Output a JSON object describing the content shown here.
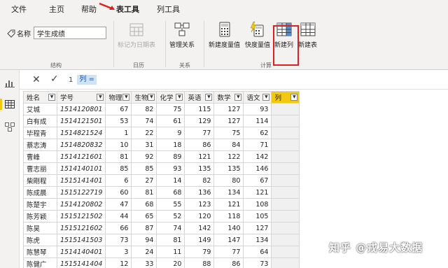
{
  "menu": {
    "file": "文件",
    "home": "主页",
    "help": "帮助",
    "table_tools": "表工具",
    "column_tools": "列工具"
  },
  "ribbon": {
    "name_label": "名称",
    "name_value": "学生成绩",
    "mark_date_table": "标记为日期表",
    "manage_relationships": "管理关系",
    "new_measure": "新建度量值",
    "quick_measure": "快度量值",
    "new_column": "新建列",
    "new_table": "新建表",
    "groups": {
      "structure": "结构",
      "calendar": "日历",
      "relationships": "关系",
      "calculations": "计算"
    }
  },
  "formula_bar": {
    "line_number": "1",
    "text": "列 ="
  },
  "table": {
    "headers": [
      "姓名",
      "学号",
      "物理",
      "生物",
      "化学",
      "英语",
      "数学",
      "语文",
      "列"
    ],
    "rows": [
      [
        "艾城",
        "1514120801",
        "67",
        "82",
        "75",
        "115",
        "127",
        "93"
      ],
      [
        "白有成",
        "1514121501",
        "53",
        "74",
        "61",
        "129",
        "127",
        "114"
      ],
      [
        "毕程青",
        "1514821524",
        "1",
        "22",
        "9",
        "77",
        "75",
        "62"
      ],
      [
        "蔡志涛",
        "1514820832",
        "10",
        "31",
        "18",
        "86",
        "84",
        "71"
      ],
      [
        "曹峰",
        "1514121601",
        "81",
        "92",
        "89",
        "121",
        "122",
        "142"
      ],
      [
        "曹志丽",
        "1514140101",
        "85",
        "85",
        "93",
        "135",
        "135",
        "146"
      ],
      [
        "柴剛程",
        "1515141401",
        "6",
        "27",
        "14",
        "82",
        "80",
        "67"
      ],
      [
        "陈成晨",
        "1515122719",
        "60",
        "81",
        "68",
        "136",
        "134",
        "121"
      ],
      [
        "陈楚宇",
        "1514120802",
        "47",
        "68",
        "55",
        "123",
        "121",
        "108"
      ],
      [
        "陈芳颖",
        "1515121502",
        "44",
        "65",
        "52",
        "120",
        "118",
        "105"
      ],
      [
        "陈昊",
        "1515121602",
        "66",
        "87",
        "74",
        "142",
        "140",
        "127"
      ],
      [
        "陈虎",
        "1515141503",
        "73",
        "94",
        "81",
        "149",
        "147",
        "134"
      ],
      [
        "陈慧琴",
        "1514140401",
        "3",
        "24",
        "11",
        "79",
        "77",
        "64"
      ],
      [
        "陈健广",
        "1515141404",
        "12",
        "33",
        "20",
        "88",
        "86",
        "73"
      ]
    ]
  },
  "watermark": "知乎 @戎易大数据",
  "colors": {
    "accent_yellow": "#f2c811",
    "highlight_red": "#e01f1f",
    "ribbon_bg": "#f3f2f1"
  },
  "icons": {
    "name_tag": "tag-icon",
    "report_view": "bar-chart-icon",
    "data_view": "table-icon",
    "model_view": "model-icon"
  }
}
